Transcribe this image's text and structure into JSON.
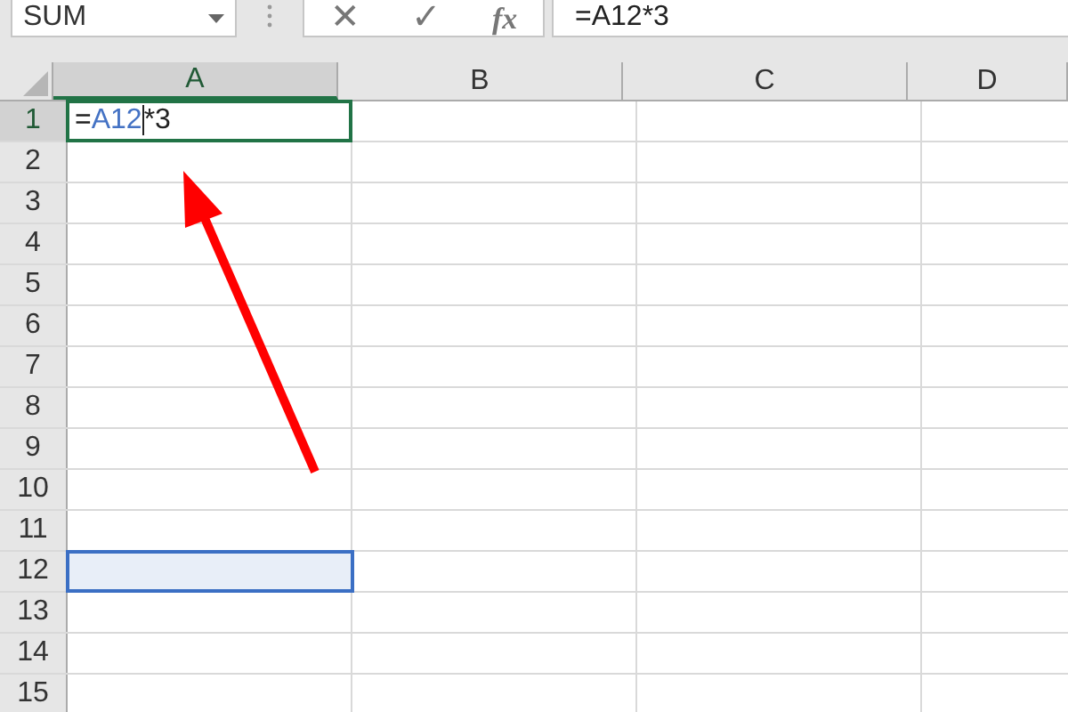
{
  "name_box": {
    "value": "SUM"
  },
  "formula_bar": {
    "cancel": "✕",
    "enter": "✓",
    "function": "fx",
    "value": "=A12*3"
  },
  "columns": [
    {
      "label": "A",
      "selected": true
    },
    {
      "label": "B",
      "selected": false
    },
    {
      "label": "C",
      "selected": false
    },
    {
      "label": "D",
      "selected": false
    }
  ],
  "rows": [
    {
      "label": "1",
      "selected": true,
      "referenced": false
    },
    {
      "label": "2",
      "selected": false,
      "referenced": false
    },
    {
      "label": "3",
      "selected": false,
      "referenced": false
    },
    {
      "label": "4",
      "selected": false,
      "referenced": false
    },
    {
      "label": "5",
      "selected": false,
      "referenced": false
    },
    {
      "label": "6",
      "selected": false,
      "referenced": false
    },
    {
      "label": "7",
      "selected": false,
      "referenced": false
    },
    {
      "label": "8",
      "selected": false,
      "referenced": false
    },
    {
      "label": "9",
      "selected": false,
      "referenced": false
    },
    {
      "label": "10",
      "selected": false,
      "referenced": false
    },
    {
      "label": "11",
      "selected": false,
      "referenced": false
    },
    {
      "label": "12",
      "selected": false,
      "referenced": true
    },
    {
      "label": "13",
      "selected": false,
      "referenced": false
    },
    {
      "label": "14",
      "selected": false,
      "referenced": false
    },
    {
      "label": "15",
      "selected": false,
      "referenced": false
    }
  ],
  "active_cell": {
    "parts": [
      {
        "kind": "text",
        "text": "="
      },
      {
        "kind": "reference",
        "text": "A12"
      },
      {
        "kind": "text",
        "text": "*3"
      }
    ]
  }
}
